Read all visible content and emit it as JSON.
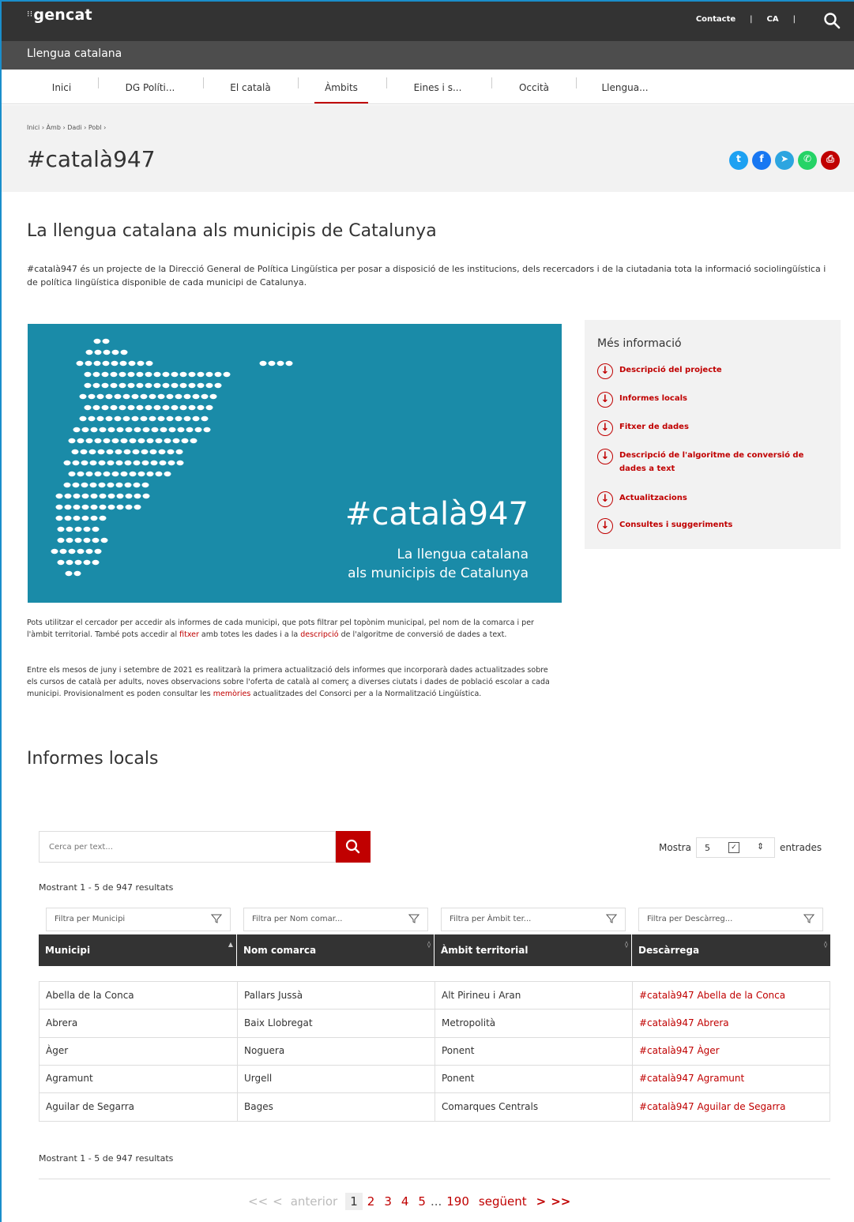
{
  "header": {
    "logo": "gencat",
    "logo_glyph": "⁝⁝",
    "contact": "Contacte",
    "sep": "|",
    "lang": "CA",
    "site_title": "Llengua catalana"
  },
  "nav": {
    "items": [
      "Inici",
      "DG Políti...",
      "El català",
      "Àmbits",
      "Eines i s...",
      "Occità",
      "Llengua..."
    ],
    "active": "Àmbits"
  },
  "breadcrumb": "Inici  ›  Àmb  ›  Dadi  ›  Pobl  ›",
  "page_title": "#català947",
  "share": [
    {
      "icon": "twitter-icon",
      "glyph": "t",
      "color": "#1da1f2"
    },
    {
      "icon": "facebook-icon",
      "glyph": "f",
      "color": "#1877f2"
    },
    {
      "icon": "telegram-icon",
      "glyph": "➤",
      "color": "#2ca5e0"
    },
    {
      "icon": "whatsapp-icon",
      "glyph": "✆",
      "color": "#25d366"
    },
    {
      "icon": "print-icon",
      "glyph": "⎙",
      "color": "#c00000"
    }
  ],
  "intro": {
    "title": "La llengua catalana als municipis de Catalunya",
    "text": "#català947 és un projecte de la Direcció General de Política Lingüística per posar a disposició de les institucions, dels recercadors i de la ciutadania tota la informació sociolingüística i de política lingüística disponible de cada municipi de Catalunya."
  },
  "hero": {
    "title": "#català947",
    "subtitle_1": "La llengua catalana",
    "subtitle_2": "als municipis de Catalunya"
  },
  "more_info": {
    "title": "Més informació",
    "links": [
      "Descripció del projecte",
      "Informes locals",
      "Fitxer de dades",
      "Descripció de l'algoritme de conversió de dades a text",
      "Actualitzacions",
      "Consultes i suggeriments"
    ]
  },
  "para1": {
    "a": "Pots utilitzar el cercador per accedir als informes de cada municipi, que pots filtrar pel topònim municipal, pel nom de la comarca i per l'àmbit territorial. També pots accedir al ",
    "link1": "fitxer",
    "b": " amb totes les dades i a la ",
    "link2": "descripció",
    "c": " de l'algoritme de conversió de dades a text."
  },
  "para2": {
    "a": "Entre els mesos de juny i setembre de 2021 es realitzarà la primera actualització dels informes que incorporarà dades actualitzades sobre els cursos de català per adults, noves observacions sobre l'oferta de català al comerç a diverses ciutats i dades de població escolar a cada municipi. Provisionalment es poden consultar les ",
    "link": "memòries",
    "b": " actualitzades del Consorci per a la Normalització Lingüística."
  },
  "reports": {
    "title": "Informes locals",
    "search_placeholder": "Cerca per text...",
    "show_label": "Mostra",
    "show_value": "5",
    "show_check": "✓",
    "show_updown": "⇕",
    "entries_label": "entrades",
    "count_text": "Mostrant 1 - 5 de 947 resultats",
    "filters": [
      "Filtra per Municipi",
      "Filtra per Nom comar...",
      "Filtra per Àmbit ter...",
      "Filtra per Descàrreg..."
    ],
    "sort_first": "▲",
    "sort_other": "◊",
    "columns": [
      "Municipi",
      "Nom comarca",
      "Àmbit territorial",
      "Descàrrega"
    ],
    "rows": [
      [
        "Abella de la Conca",
        "Pallars Jussà",
        "Alt Pirineu i Aran",
        "#català947 Abella de la Conca"
      ],
      [
        "Abrera",
        "Baix Llobregat",
        "Metropolità",
        "#català947 Abrera"
      ],
      [
        "Àger",
        "Noguera",
        "Ponent",
        "#català947 Àger"
      ],
      [
        "Agramunt",
        "Urgell",
        "Ponent",
        "#català947 Agramunt"
      ],
      [
        "Aguilar de Segarra",
        "Bages",
        "Comarques Centrals",
        "#català947 Aguilar de Segarra"
      ]
    ]
  },
  "pagination": {
    "first": "<<",
    "prev_arrow": "<",
    "prev": "anterior",
    "current": "1",
    "pages": [
      "2",
      "3",
      "4",
      "5"
    ],
    "ellipsis": "...",
    "last_page": "190",
    "next": "següent",
    "next_arrow": ">",
    "last": ">>"
  }
}
